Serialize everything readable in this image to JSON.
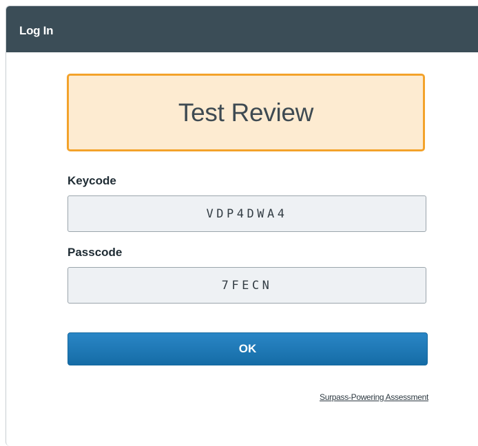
{
  "dialog": {
    "title": "Log In"
  },
  "exam": {
    "title": "Test Review"
  },
  "keycode": {
    "label": "Keycode",
    "value": "VDP4DWA4"
  },
  "passcode": {
    "label": "Passcode",
    "value": "7FECN"
  },
  "actions": {
    "ok_label": "OK"
  },
  "footer": {
    "link_text": "Surpass-Powering Assessment"
  },
  "colors": {
    "header_bg": "#3b4d57",
    "exam_box_bg": "#fdebd1",
    "exam_box_border": "#f3a22a",
    "button_bg": "#1f7ab8",
    "input_bg": "#eef1f4"
  }
}
